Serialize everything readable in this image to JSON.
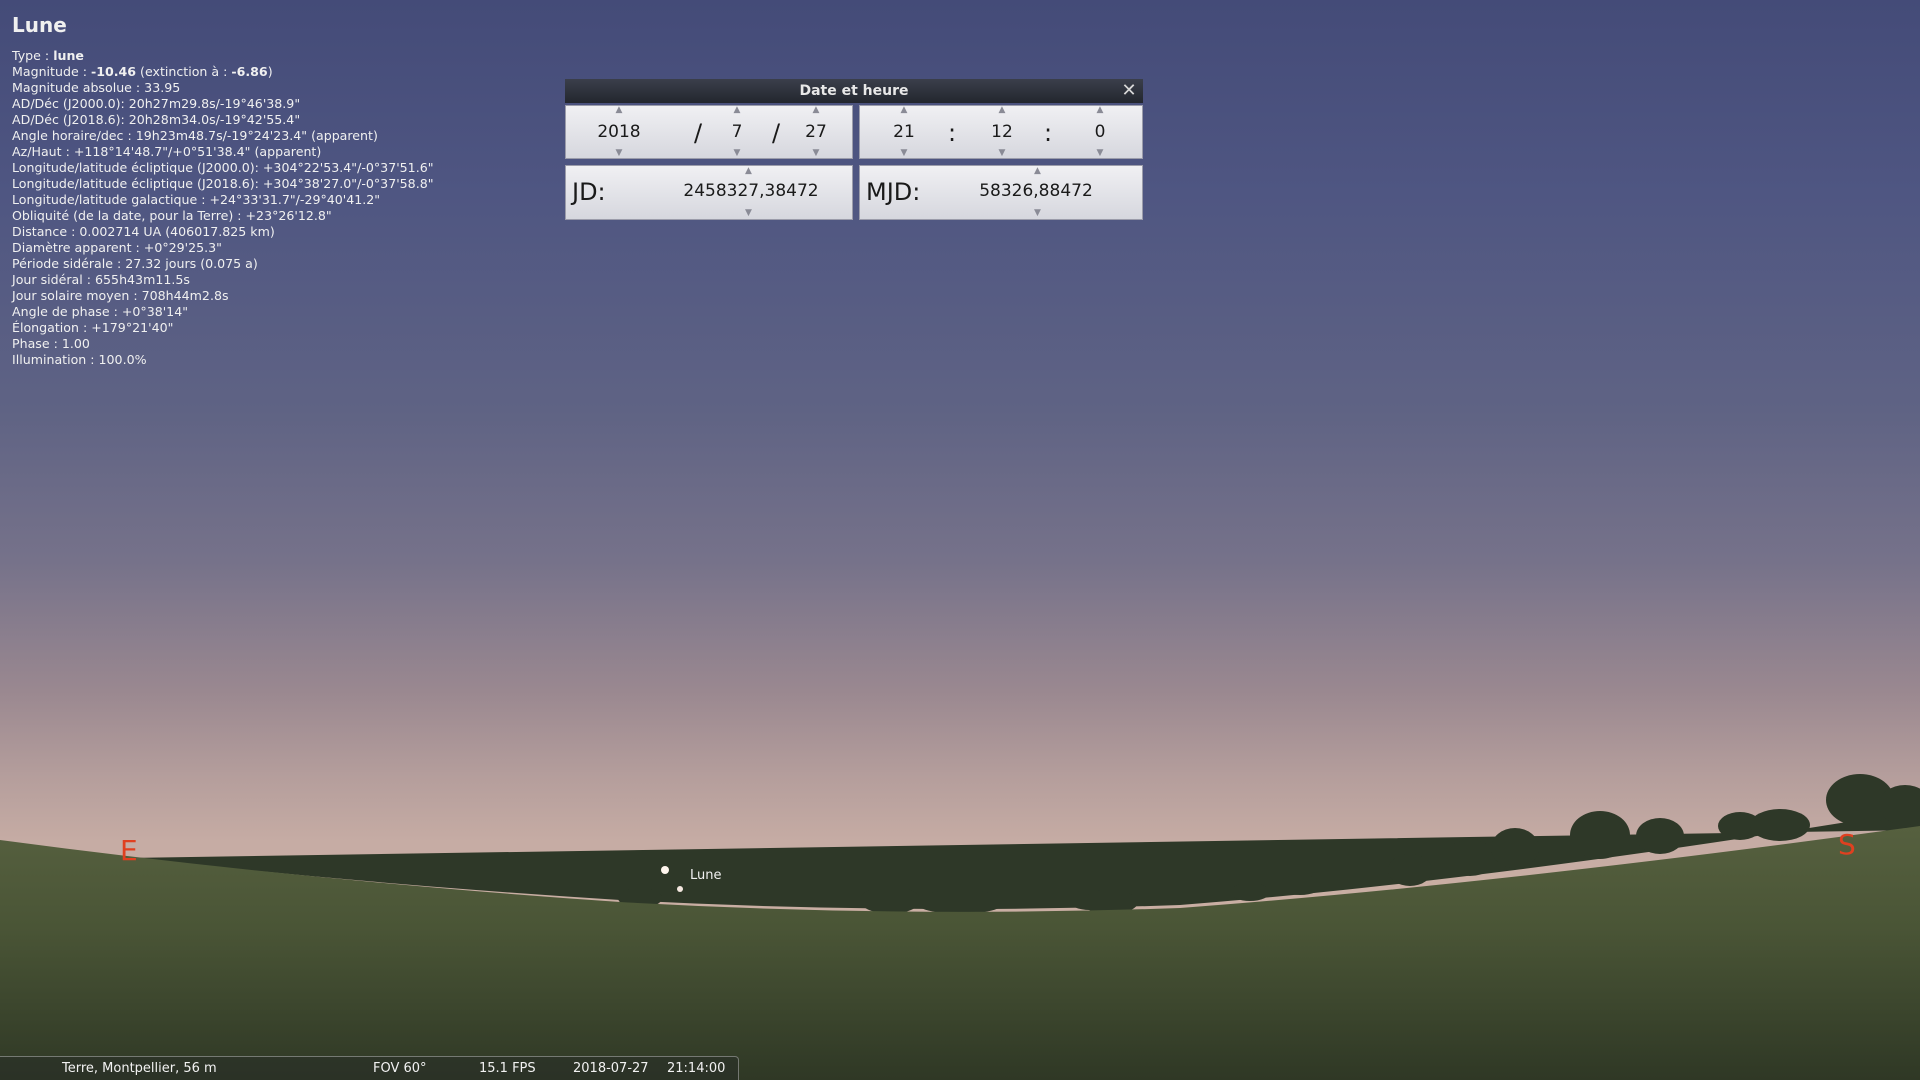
{
  "info": {
    "title": "Lune",
    "lines": [
      {
        "label": "Type : ",
        "bold": "lune",
        "rest": ""
      },
      {
        "label": "Magnitude : ",
        "bold": "-10.46",
        "rest": " (extinction à : ",
        "bold2": "-6.86",
        "rest2": ")"
      },
      {
        "label": "Magnitude absolue : 33.95"
      },
      {
        "label": "AD/Déc (J2000.0): 20h27m29.8s/-19°46'38.9\""
      },
      {
        "label": "AD/Déc (J2018.6): 20h28m34.0s/-19°42'55.4\""
      },
      {
        "label": "Angle horaire/dec : 19h23m48.7s/-19°24'23.4\" (apparent)"
      },
      {
        "label": "Az/Haut : +118°14'48.7\"/+0°51'38.4\" (apparent)"
      },
      {
        "label": "Longitude/latitude écliptique (J2000.0): +304°22'53.4\"/-0°37'51.6\""
      },
      {
        "label": "Longitude/latitude écliptique (J2018.6): +304°38'27.0\"/-0°37'58.8\""
      },
      {
        "label": "Longitude/latitude galactique : +24°33'31.7\"/-29°40'41.2\""
      },
      {
        "label": "Obliquité (de la date, pour la Terre) : +23°26'12.8\""
      },
      {
        "label": "Distance : 0.002714 UA (406017.825 km)"
      },
      {
        "label": "Diamètre apparent : +0°29'25.3\""
      },
      {
        "label": "Période sidérale : 27.32 jours (0.075 a)"
      },
      {
        "label": "Jour sidéral : 655h43m11.5s"
      },
      {
        "label": "Jour solaire moyen : 708h44m2.8s"
      },
      {
        "label": "Angle de phase : +0°38'14\""
      },
      {
        "label": "Élongation : +179°21'40\""
      },
      {
        "label": "Phase : 1.00"
      },
      {
        "label": "Illumination : 100.0%"
      }
    ]
  },
  "date_window": {
    "title": "Date et heure",
    "close_icon": "close-icon",
    "year": "2018",
    "month": "7",
    "day": "27",
    "date_sep": "/",
    "hour": "21",
    "minute": "12",
    "second": "0",
    "time_sep": ":",
    "jd_label": "JD:",
    "jd_value": "2458327,38472",
    "mjd_label": "MJD:",
    "mjd_value": "58326,88472",
    "arrow_up": "▲",
    "arrow_down": "▼"
  },
  "sky": {
    "cardinal_east": "E",
    "cardinal_south": "S",
    "moon_label": "Lune"
  },
  "status_bar": {
    "location": "Terre, Montpellier, 56 m",
    "fov": "FOV 60°",
    "fps": "15.1 FPS",
    "date": "2018-07-27",
    "time": "21:14:00"
  },
  "colors": {
    "cardinal": "#e04020",
    "sky_top": "#444b78",
    "sky_horizon": "#c9aea3",
    "ground": "#4c5a3a"
  }
}
